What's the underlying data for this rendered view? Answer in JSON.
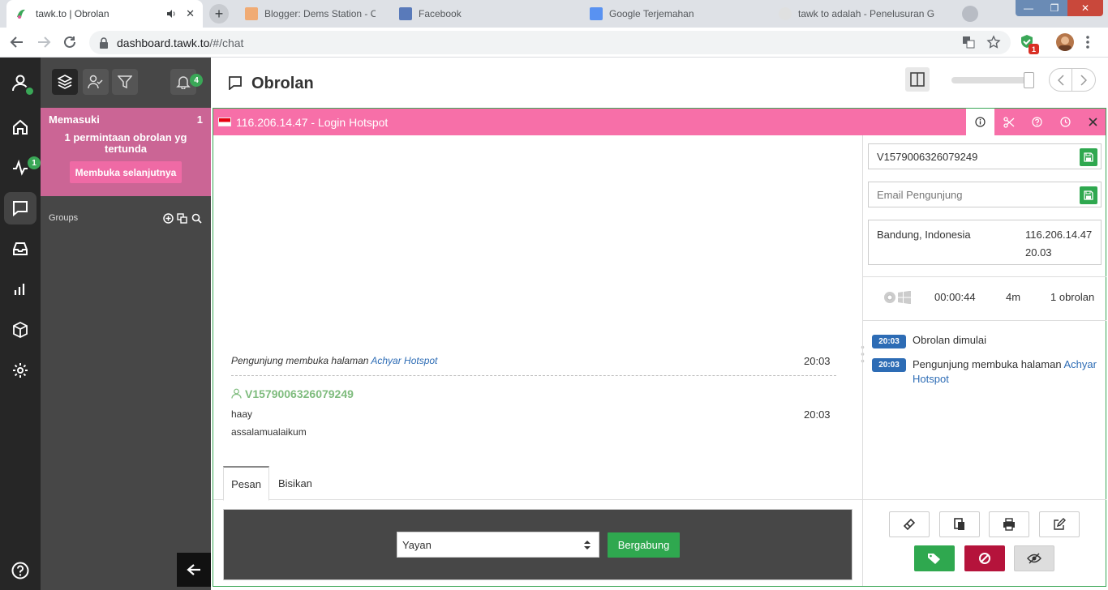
{
  "browser": {
    "active_tab": {
      "title": "tawk.to | Obrolan"
    },
    "inactive_tabs": [
      {
        "title": "Blogger: Dems Station - Overv"
      },
      {
        "title": "Facebook"
      },
      {
        "title": "Google Terjemahan"
      },
      {
        "title": "tawk to adalah - Penelusuran G"
      }
    ],
    "url_host": "dashboard.tawk.to",
    "url_path": "/#/chat",
    "ext_badge": "1",
    "window_controls": {
      "minimize": "—",
      "restore": "❐",
      "close": "✕"
    }
  },
  "rail": {
    "activity_badge": "1"
  },
  "side": {
    "notif_badge": "4",
    "incoming": {
      "title": "Memasuki",
      "count": "1",
      "message": "1 permintaan obrolan yg tertunda",
      "open_next": "Membuka selanjutnya"
    },
    "groups_label": "Groups"
  },
  "header": {
    "title": "Obrolan"
  },
  "chat": {
    "title": "116.206.14.47 - Login Hotspot",
    "flag": "Indonesia",
    "messages": {
      "visit_prefix": "Pengunjung membuka halaman ",
      "visit_link": "Achyar Hotspot",
      "visit_time": "20:03",
      "visitor_name": "V1579006326079249",
      "msg1": "haay",
      "msg1_time": "20:03",
      "msg2": "assalamualaikum"
    },
    "tabs": {
      "message": "Pesan",
      "whisper": "Bisikan"
    },
    "agent_select": "Yayan",
    "join_button": "Bergabung"
  },
  "visitor": {
    "name": "V1579006326079249",
    "email_placeholder": "Email Pengunjung",
    "location": "Bandung, Indonesia",
    "ip": "116.206.14.47",
    "local_time": "20.03",
    "duration": "00:00:44",
    "time_on_site": "4m",
    "chat_count": "1 obrolan",
    "timeline": [
      {
        "time": "20:03",
        "text": "Obrolan dimulai"
      },
      {
        "time": "20:03",
        "prefix": "Pengunjung membuka halaman ",
        "link": "Achyar Hotspot"
      }
    ]
  },
  "colors": {
    "incoming_bg": "#cb6595",
    "chat_header": "#f76fa8",
    "accent_green": "#2fa84f",
    "link_blue": "#2d6cb5",
    "ban_red": "#b5133b"
  }
}
